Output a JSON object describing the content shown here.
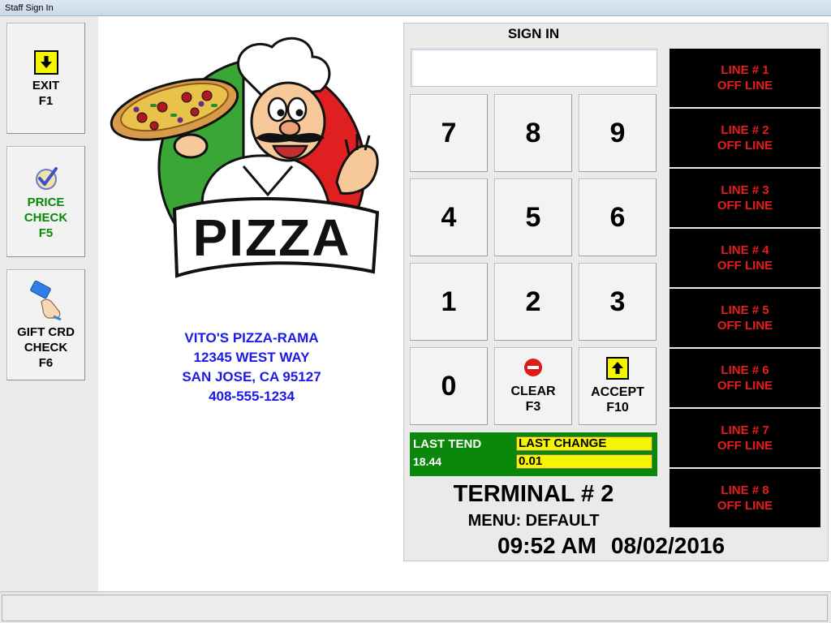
{
  "window": {
    "title": "Staff Sign In"
  },
  "sidebar": {
    "exit": {
      "line1": "EXIT",
      "line2": "F1"
    },
    "price_check": {
      "line1": "PRICE",
      "line2": "CHECK",
      "line3": "F5"
    },
    "gift_card": {
      "line1": "GIFT CRD",
      "line2": "CHECK",
      "line3": "F6"
    }
  },
  "logo": {
    "text": "PIZZA"
  },
  "store": {
    "name": "VITO'S PIZZA-RAMA",
    "street": "12345 WEST WAY",
    "city": "SAN JOSE, CA 95127",
    "phone": "408-555-1234"
  },
  "signin": {
    "label": "SIGN IN",
    "value": ""
  },
  "keypad": {
    "k7": "7",
    "k8": "8",
    "k9": "9",
    "k4": "4",
    "k5": "5",
    "k6": "6",
    "k1": "1",
    "k2": "2",
    "k3": "3",
    "k0": "0",
    "clear": {
      "line1": "CLEAR",
      "line2": "F3"
    },
    "accept": {
      "line1": "ACCEPT",
      "line2": "F10"
    }
  },
  "tender": {
    "last_tend_label": "LAST TEND",
    "last_tend_value": "18.44",
    "last_change_label": "LAST CHANGE",
    "last_change_value": "0.01"
  },
  "terminal": {
    "title": "TERMINAL # 2",
    "menu": "MENU: DEFAULT",
    "time": "09:52 AM",
    "date": "08/02/2016"
  },
  "lines": [
    {
      "name": "LINE # 1",
      "status": "OFF LINE"
    },
    {
      "name": "LINE # 2",
      "status": "OFF LINE"
    },
    {
      "name": "LINE # 3",
      "status": "OFF LINE"
    },
    {
      "name": "LINE # 4",
      "status": "OFF LINE"
    },
    {
      "name": "LINE # 5",
      "status": "OFF LINE"
    },
    {
      "name": "LINE # 6",
      "status": "OFF LINE"
    },
    {
      "name": "LINE # 7",
      "status": "OFF LINE"
    },
    {
      "name": "LINE # 8",
      "status": "OFF LINE"
    }
  ],
  "icons": {
    "exit": "down-arrow-icon",
    "price_check": "checkmark-icon",
    "gift_card": "gift-card-hand-icon",
    "clear": "no-entry-icon",
    "accept": "up-arrow-icon"
  },
  "colors": {
    "line_bg": "#000000",
    "line_text": "#e81c1c",
    "tender_bg": "#0b870b",
    "change_bg": "#f5f500",
    "address_text": "#1a1ae6",
    "price_check_text": "#078a07"
  }
}
